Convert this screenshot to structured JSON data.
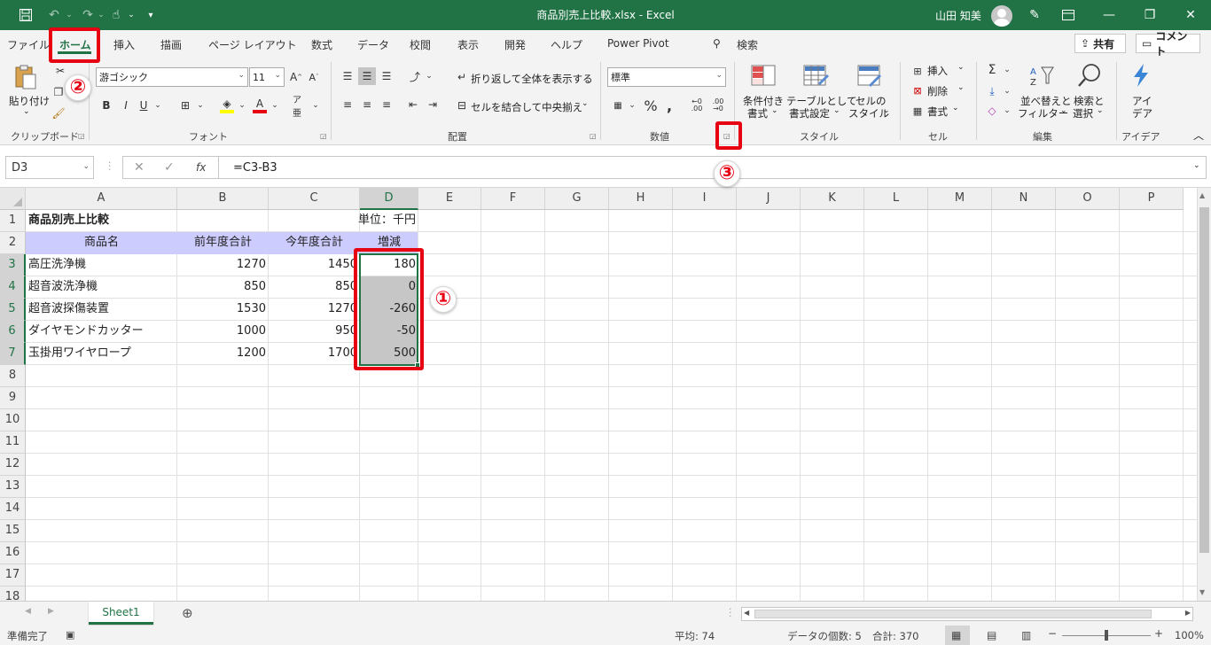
{
  "window": {
    "title": "商品別売上比較.xlsx  -  Excel",
    "user": "山田 知美"
  },
  "tabs": [
    "ファイル",
    "ホーム",
    "挿入",
    "描画",
    "ページ レイアウト",
    "数式",
    "データ",
    "校閲",
    "表示",
    "開発",
    "ヘルプ",
    "Power Pivot"
  ],
  "search_label": "検索",
  "share_label": "共有",
  "comment_label": "コメント",
  "ribbon": {
    "clipboard": {
      "paste_label": "貼り付け",
      "group": "クリップボード"
    },
    "font": {
      "name": "游ゴシック",
      "size": "11",
      "group": "フォント"
    },
    "alignment": {
      "wrap": "折り返して全体を表示する",
      "merge": "セルを結合して中央揃え",
      "group": "配置"
    },
    "number": {
      "format": "標準",
      "group": "数値"
    },
    "styles": {
      "cond1": "条件付き",
      "cond2": "書式",
      "table1": "テーブルとして",
      "table2": "書式設定",
      "cellstyle1": "セルの",
      "cellstyle2": "スタイル",
      "group": "スタイル"
    },
    "cells": {
      "insert": "挿入",
      "delete": "削除",
      "format": "書式",
      "group": "セル"
    },
    "editing": {
      "sort1": "並べ替えと",
      "sort2": "フィルター",
      "find1": "検索と",
      "find2": "選択",
      "group": "編集"
    },
    "ideas": {
      "l1": "アイ",
      "l2": "デア",
      "group": "アイデア"
    }
  },
  "formula": {
    "namebox": "D3",
    "formula": "=C3-B3"
  },
  "columns": [
    "A",
    "B",
    "C",
    "D",
    "E",
    "F",
    "G",
    "H",
    "I",
    "J",
    "K",
    "L",
    "M",
    "N",
    "O",
    "P"
  ],
  "rows": [
    "1",
    "2",
    "3",
    "4",
    "5",
    "6",
    "7",
    "8",
    "9",
    "10",
    "11",
    "12",
    "13",
    "14",
    "15",
    "16",
    "17",
    "18"
  ],
  "cells": {
    "A1": "商品別売上比較",
    "C1": "単位：千円",
    "A2": "商品名",
    "B2": "前年度合計",
    "C2": "今年度合計",
    "D2": "増減",
    "A3": "高圧洗浄機",
    "B3": "1270",
    "C3": "1450",
    "D3": "180",
    "A4": "超音波洗浄機",
    "B4": "850",
    "C4": "850",
    "D4": "0",
    "A5": "超音波探傷装置",
    "B5": "1530",
    "C5": "1270",
    "D5": "-260",
    "A6": "ダイヤモンドカッター",
    "B6": "1000",
    "C6": "950",
    "D6": "-50",
    "A7": "玉掛用ワイヤロープ",
    "B7": "1200",
    "C7": "1700",
    "D7": "500"
  },
  "sheet": {
    "name": "Sheet1"
  },
  "status": {
    "ready": "準備完了",
    "average": "平均: 74",
    "count": "データの個数: 5",
    "sum": "合計: 370",
    "zoom": "100%"
  },
  "annotations": {
    "one": "①",
    "two": "②",
    "three": "③"
  },
  "colors": {
    "excel_green": "#217346",
    "header_fill": "#ccccff",
    "selection": "#c6c6c6",
    "callout_red": "#e60012"
  }
}
